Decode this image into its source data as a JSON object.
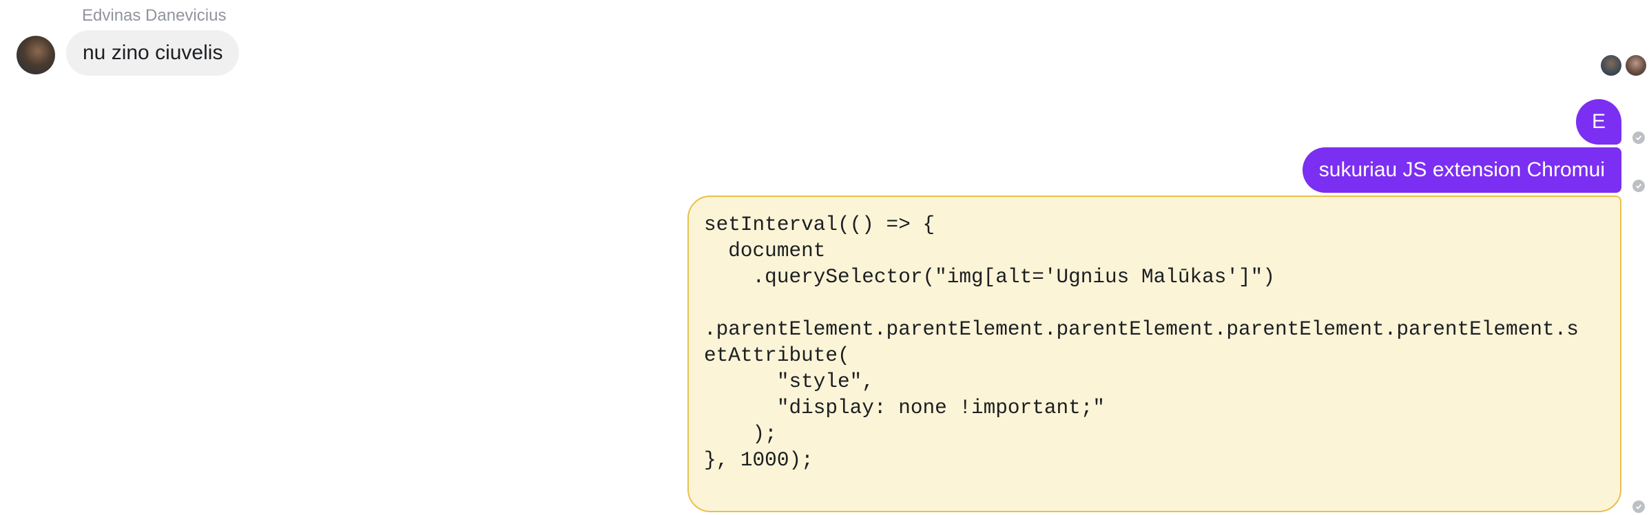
{
  "incoming": {
    "sender_name": "Edvinas Danevicius",
    "message": "nu zino ciuvelis"
  },
  "outgoing": [
    {
      "text": "E"
    },
    {
      "text": "sukuriau JS extension Chromui"
    }
  ],
  "code_message": {
    "lines": [
      "setInterval(() => {",
      "  document",
      "    .querySelector(\"img[alt='Ugnius Malūkas']\")",
      "",
      ".parentElement.parentElement.parentElement.parentElement.parentElement.s",
      "etAttribute(",
      "      \"style\",",
      "      \"display: none !important;\"",
      "    );",
      "}, 1000);"
    ]
  },
  "colors": {
    "outgoing_bubble": "#7b2ff2",
    "incoming_bubble": "#f0f0f0",
    "code_bubble_bg": "#fbf4d7",
    "code_bubble_border": "#e8c14b"
  },
  "icons": [
    "sender-avatar",
    "seen-avatar",
    "delivered-check-icon"
  ]
}
